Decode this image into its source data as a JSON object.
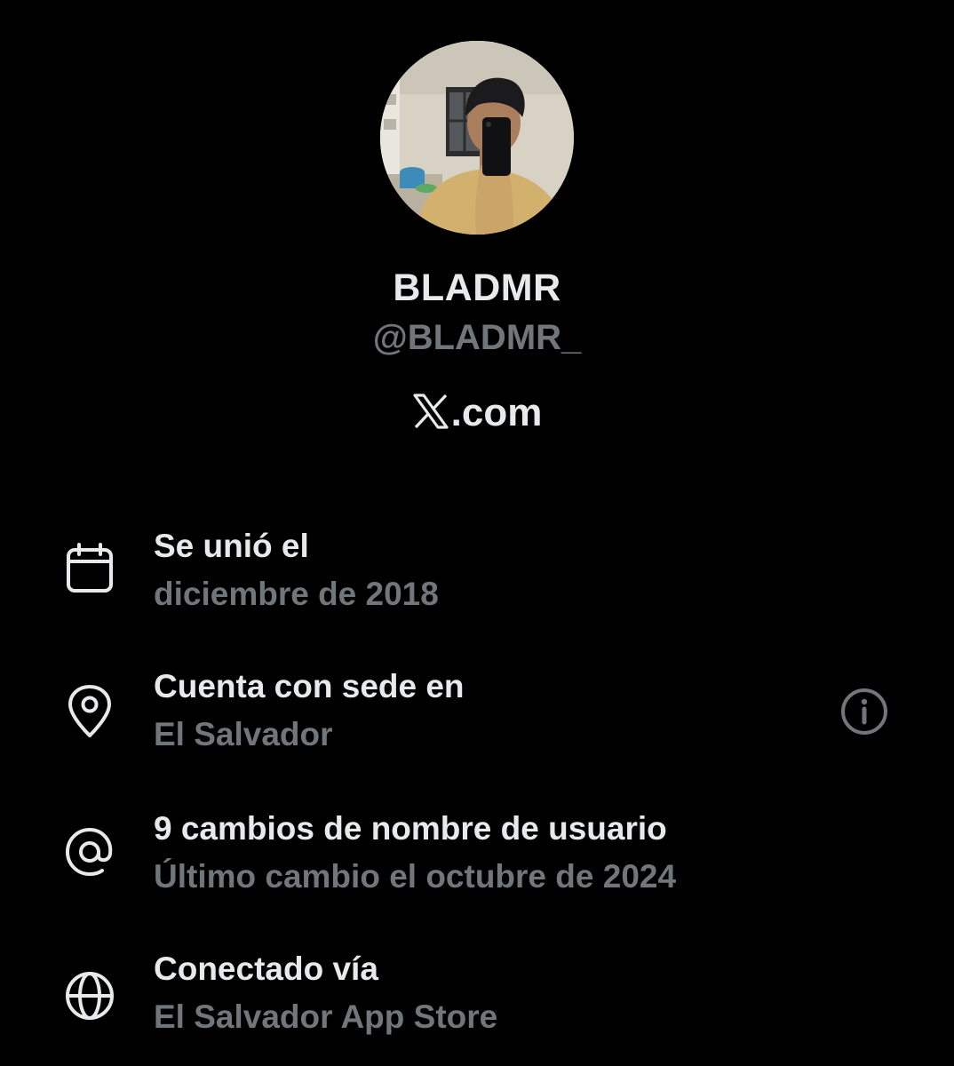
{
  "profile": {
    "display_name": "BLADMR",
    "handle": "@BLADMR_",
    "site_label": ".com",
    "site_logo_icon": "x-logo-icon",
    "avatar_icon": "profile-photo"
  },
  "details": [
    {
      "icon": "calendar-icon",
      "title": "Se unió el",
      "subtitle": "diciembre de 2018"
    },
    {
      "icon": "location-pin-icon",
      "title": "Cuenta con sede en",
      "subtitle": "El Salvador",
      "action_icon": "info-icon"
    },
    {
      "icon": "at-sign-icon",
      "title": "9 cambios de nombre de usuario",
      "subtitle": "Último cambio el octubre de 2024"
    },
    {
      "icon": "globe-icon",
      "title": "Conectado vía",
      "subtitle": "El Salvador App Store"
    }
  ],
  "colors": {
    "background": "#000000",
    "primary_text": "#e7e9ea",
    "secondary_text": "#71767b"
  }
}
